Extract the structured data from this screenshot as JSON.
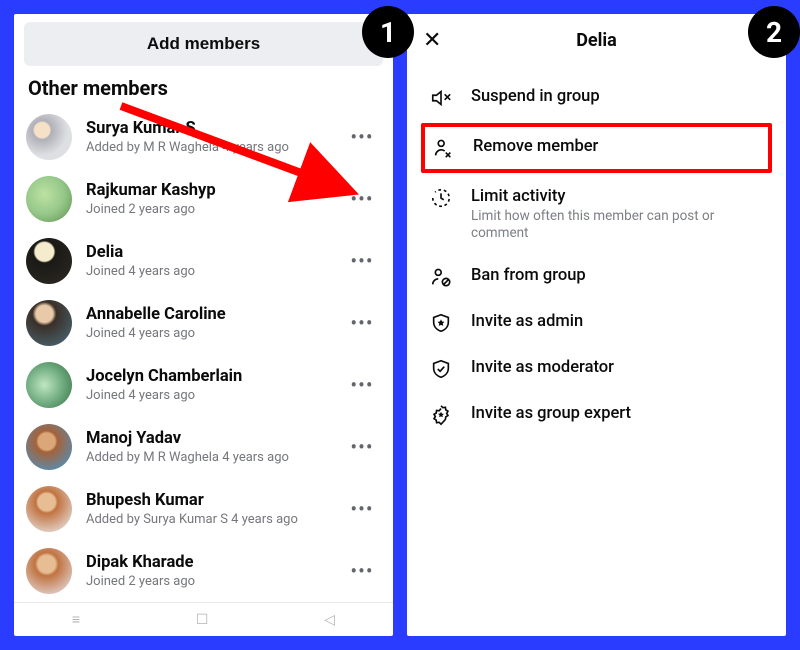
{
  "left": {
    "add_button": "Add members",
    "section": "Other members",
    "members": [
      {
        "name": "Surya Kumar S",
        "sub": "Added by M R Waghela 4 years ago"
      },
      {
        "name": "Rajkumar Kashyp",
        "sub": "Joined 2 years ago"
      },
      {
        "name": "Delia",
        "sub": "Joined 4 years ago"
      },
      {
        "name": "Annabelle Caroline",
        "sub": "Joined 4 years ago"
      },
      {
        "name": "Jocelyn Chamberlain",
        "sub": "Joined 4 years ago"
      },
      {
        "name": "Manoj Yadav",
        "sub": "Added by M R Waghela 4 years ago"
      },
      {
        "name": "Bhupesh Kumar",
        "sub": "Added by Surya Kumar S 4 years ago"
      },
      {
        "name": "Dipak Kharade",
        "sub": "Joined 2 years ago"
      }
    ]
  },
  "right": {
    "title": "Delia",
    "actions": {
      "suspend": "Suspend in group",
      "remove": "Remove member",
      "limit": "Limit activity",
      "limit_sub": "Limit how often this member can post or comment",
      "ban": "Ban from group",
      "invite_admin": "Invite as admin",
      "invite_mod": "Invite as moderator",
      "invite_expert": "Invite as group expert"
    }
  },
  "steps": {
    "one": "1",
    "two": "2"
  }
}
